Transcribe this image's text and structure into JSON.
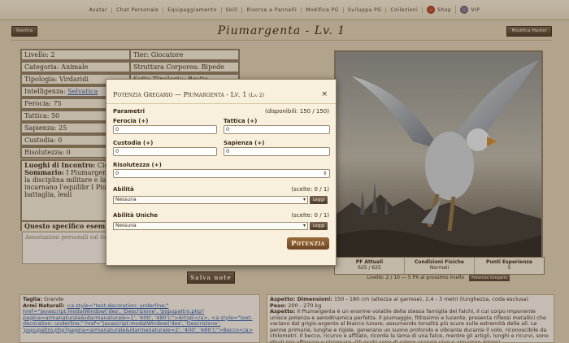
{
  "nav": [
    {
      "label": "Avatar"
    },
    {
      "label": "Chat Personale"
    },
    {
      "label": "Equipaggiamento"
    },
    {
      "label": "Skill"
    },
    {
      "label": "Risorse e Pannelli"
    },
    {
      "label": "Modifica PG"
    },
    {
      "label": "Sviluppa PG"
    },
    {
      "label": "Collezioni"
    },
    {
      "label": "Shop",
      "icon": "shop-icon"
    },
    {
      "label": "VIP",
      "icon": "vip-icon"
    }
  ],
  "header": {
    "left_button": "Rientra",
    "title": "Piumargenta - Lv. 1",
    "right_button": "Modifica Master"
  },
  "fields": {
    "livello": {
      "label": "Livello:",
      "value": "2"
    },
    "tier": {
      "label": "Tier:",
      "value": "Giocatore"
    },
    "categoria": {
      "label": "Categoria:",
      "value": "Animale"
    },
    "struttura": {
      "label": "Struttura Corporea:",
      "value": "Bipede"
    },
    "tipologia": {
      "label": "Tipologia:",
      "value": "Virdaridi"
    },
    "sottotipologia": {
      "label": "Sotto Tipologia:",
      "value": "Bestie"
    },
    "intelligenza": {
      "label": "Intelligenza:",
      "value": "Selvatica"
    },
    "ferocia": {
      "label": "Ferocia:",
      "value": "75"
    },
    "tattica": {
      "label": "Tattica:",
      "value": "50"
    },
    "sapienza": {
      "label": "Sapienza:",
      "value": "25"
    },
    "custodia": {
      "label": "Custodia:",
      "value": "0"
    },
    "risolutezza": {
      "label": "Risolutezza:",
      "value": "0"
    },
    "luoghi": {
      "label": "Luoghi di Incontro:",
      "value": "Cieli e"
    }
  },
  "sommario": {
    "label": "Sommario:",
    "text": "I Piumargenta - addestrati dalla Gilda dei Fa per la disciplina militare e la terrestre quanto aereo. Que fierezza, incarnano l'equilibr I Piumargenta non sono sem compagni di battaglia, leali"
  },
  "notes": {
    "label": "Questo specifico esemplare",
    "placeholder": "Annotazioni personali sul tuo g",
    "save": "Salva note"
  },
  "stats": {
    "pf": {
      "label": "PF Attuali",
      "value": "625 / 625"
    },
    "condizioni": {
      "label": "Condizioni Fisiche",
      "value": "Normali"
    },
    "esperienza": {
      "label": "Punti Esperienza",
      "value": "5"
    }
  },
  "level_line": {
    "text": "Livello: 2 / 10 — 5 PX al prossimo livello",
    "button": "Potenzia Gregario"
  },
  "bottom_left": {
    "taglia_label": "Taglia:",
    "taglia_value": "Grande",
    "armi_label": "Armi Naturali:",
    "armi_code": "<a style=\"text-decoration: underline;\" href=\"javascript:modalWindow('des', 'Descrizione', 'popupaltro.php?pagina=armanaturale&idarmanaturale=1', '400', '480');\">Artigli</a>, <a style=\"text-decoration: underline;\" href=\"javascript:modalWindow('des', 'Descrizione', 'popupaltro.php?pagina=armanaturale&idarmanaturale=2', '400', '480');\">Becco</a>"
  },
  "bottom_right": {
    "aspetto_dim_label": "Aspetto: Dimensioni:",
    "aspetto_dim_value": "150 - 180 cm (altezza al garrese), 2,4 - 3 metri (lunghezza, coda esclusa)",
    "peso_label": "Peso:",
    "peso_value": "200 - 270 kg",
    "aspetto_label": "Aspetto:",
    "aspetto_value": "Il Piumargenta è un enorme volatile della stessa famiglia dei falchi, il cui corpo imponente unisce potenza e aerodinamica perfetta. Il piumaggio, fittissimo e lucente, presenta riflessi metallici che variano dal grigio-argento al bianco lunare, assumendo tonalità più scure sulle estremità delle ali. Le penne primarie, lunghe e rigide, generano un suono profondo e vibrante durante il volo, riconoscibile da chilometri. Il becco, ricurvo e affilato, ricorda la lama di una falce, mentre gli artigli, lunghi e ricurvi, sono ideali per afferrare e strappare. Gli occhi sono di colore arancio vivo e appaiono intensi"
  },
  "modal": {
    "title": "Potenzia Gregario — Piumargenta - Lv. 1",
    "subtitle": "(Liv 2)",
    "close": "×",
    "parametri_label": "Parametri",
    "disponibili": "(disponibili: 150 / 150)",
    "ferocia_label": "Ferocia (+)",
    "ferocia_value": "0",
    "tattica_label": "Tattica (+)",
    "tattica_value": "0",
    "custodia_label": "Custodia (+)",
    "custodia_value": "0",
    "sapienza_label": "Sapienza (+)",
    "sapienza_value": "0",
    "risolutezza_label": "Risolutezza (+)",
    "risolutezza_value": "0",
    "abilita_label": "Abilità",
    "abilita_count": "(scelte: 0 / 1)",
    "abilita_select": "Nessuna",
    "abilita_uniche_label": "Abilità Uniche",
    "abilita_uniche_count": "(scelte: 0 / 1)",
    "abilita_uniche_select": "Nessuna",
    "leggi": "Leggi",
    "potenzia": "Potenzia"
  }
}
